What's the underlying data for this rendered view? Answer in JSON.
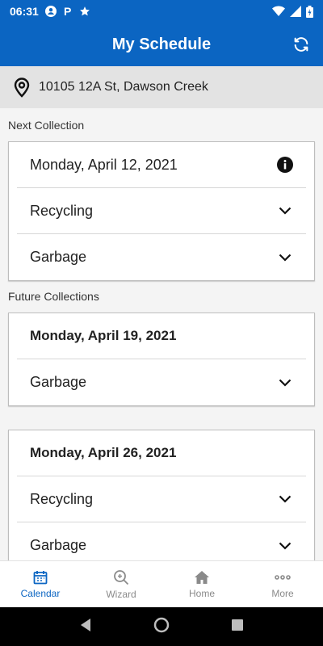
{
  "status_bar": {
    "time": "06:31"
  },
  "app_bar": {
    "title": "My Schedule"
  },
  "address": {
    "text": "10105 12A St, Dawson Creek"
  },
  "next": {
    "label": "Next Collection",
    "date": "Monday, April 12, 2021",
    "items": [
      "Recycling",
      "Garbage"
    ]
  },
  "future": {
    "label": "Future Collections",
    "cards": [
      {
        "date": "Monday, April 19, 2021",
        "items": [
          "Garbage"
        ]
      },
      {
        "date": "Monday, April 26, 2021",
        "items": [
          "Recycling",
          "Garbage"
        ]
      }
    ]
  },
  "nav": {
    "items": [
      {
        "label": "Calendar",
        "icon": "calendar-icon"
      },
      {
        "label": "Wizard",
        "icon": "wizard-icon"
      },
      {
        "label": "Home",
        "icon": "home-icon"
      },
      {
        "label": "More",
        "icon": "more-icon"
      }
    ],
    "active_index": 0
  },
  "colors": {
    "primary": "#0b65c2",
    "address_bg": "#e3e3e3",
    "page_bg": "#f4f4f4"
  }
}
